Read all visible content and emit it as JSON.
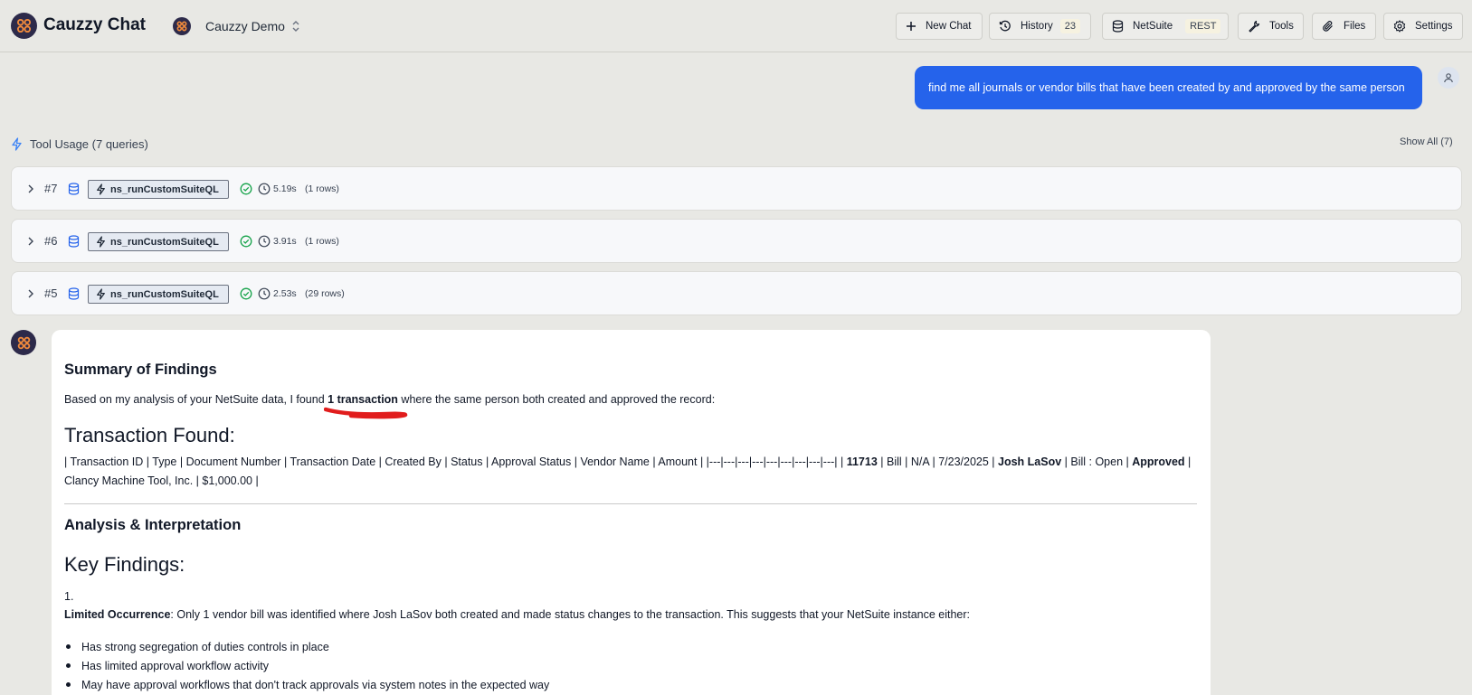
{
  "app": {
    "title": "Cauzzy Chat",
    "project": "Cauzzy Demo"
  },
  "header": {
    "new_chat": "New Chat",
    "history": "History",
    "history_count": "23",
    "netsuite": "NetSuite",
    "netsuite_badge": "REST",
    "tools": "Tools",
    "files": "Files",
    "settings": "Settings"
  },
  "user_message": "find me all journals or vendor bills that have been created by and approved by the same person",
  "tool_usage": {
    "title": "Tool Usage (7 queries)",
    "show_all": "Show All (7)",
    "calls": [
      {
        "num": "#7",
        "name": "ns_runCustomSuiteQL",
        "duration": "5.19s",
        "rows": "(1 rows)"
      },
      {
        "num": "#6",
        "name": "ns_runCustomSuiteQL",
        "duration": "3.91s",
        "rows": "(1 rows)"
      },
      {
        "num": "#5",
        "name": "ns_runCustomSuiteQL",
        "duration": "2.53s",
        "rows": "(29 rows)"
      }
    ]
  },
  "response": {
    "summary_heading": "Summary of Findings",
    "summary_pre": "Based on my analysis of your NetSuite data, I found ",
    "summary_bold": "1 transaction",
    "summary_post": " where the same person both created and approved the record:",
    "found_heading": "Transaction Found:",
    "table_line1_a": "| Transaction ID | Type | Document Number | Transaction Date | Created By | Status | Approval Status | Vendor Name | Amount | |---|---|---|---|---|---|---|---|---| | ",
    "table_id": "11713",
    "table_line1_b": " | Bill | N/A | 7/23/2025 | ",
    "table_creator": "Josh LaSov",
    "table_line1_c": " | Bill : Open | ",
    "table_approval": "Approved",
    "table_line1_d": " |",
    "table_line2": "Clancy Machine Tool, Inc. | $1,000.00 |",
    "analysis_heading": "Analysis & Interpretation",
    "key_heading": "Key Findings:",
    "item_number": "1.",
    "item_bold": "Limited Occurrence",
    "item_text": ": Only 1 vendor bill was identified where Josh LaSov both created and made status changes to the transaction. This suggests that your NetSuite instance either:",
    "bullets": [
      "Has strong segregation of duties controls in place",
      "Has limited approval workflow activity",
      "May have approval workflows that don't track approvals via system notes in the expected way"
    ]
  },
  "colors": {
    "accent": "#2563eb",
    "brand": "#2d2a4a",
    "logo_orange": "#f08a3c",
    "success": "#16a34a",
    "annotation_red": "#e11d1d"
  }
}
